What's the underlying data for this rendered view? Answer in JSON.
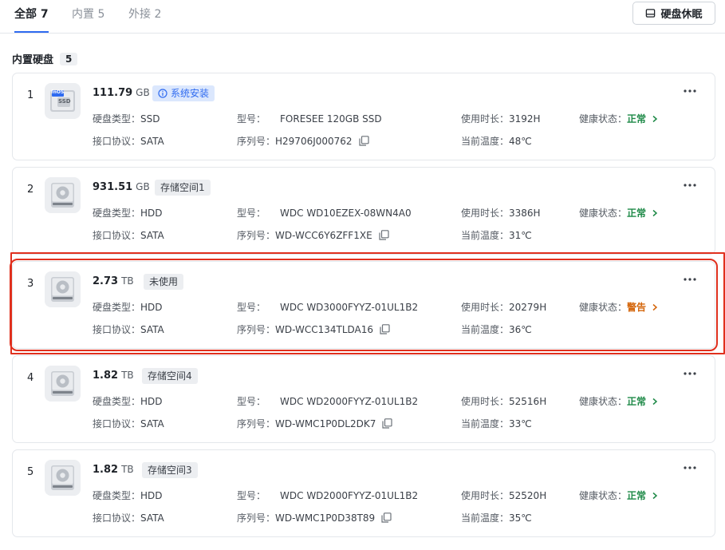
{
  "tabs": [
    {
      "label": "全部 7",
      "active": true
    },
    {
      "label": "内置 5",
      "active": false
    },
    {
      "label": "外接 2",
      "active": false
    }
  ],
  "sleep_button": {
    "label": "硬盘休眠",
    "icon": "bed-icon"
  },
  "section": {
    "title": "内置硬盘",
    "count": "5"
  },
  "labels": {
    "type": "硬盘类型：",
    "model": "型号：",
    "hours": "使用时长：",
    "health": "健康状态：",
    "proto": "接口协议：",
    "serial": "序列号：",
    "temp": "当前温度："
  },
  "colors": {
    "accent": "#2f6bf0",
    "ok": "#1f8a48",
    "warn": "#d4650a",
    "highlight": "#e0301e"
  },
  "disks": [
    {
      "index": "1",
      "capacity": "111.79",
      "unit": "GB",
      "tag": "系统安装",
      "tag_style": "blue",
      "icon": "ssd-fnos-icon",
      "icon_text_top": "fnOS",
      "icon_text_main": "SSD",
      "type": "SSD",
      "model": "FORESEE 120GB SSD",
      "hours": "3192H",
      "health": "正常",
      "health_state": "ok",
      "proto": "SATA",
      "serial": "H29706J000762",
      "temp": "48℃"
    },
    {
      "index": "2",
      "capacity": "931.51",
      "unit": "GB",
      "tag": "存储空间1",
      "tag_style": "gray",
      "icon": "hdd-icon",
      "type": "HDD",
      "model": "WDC WD10EZEX-08WN4A0",
      "hours": "3386H",
      "health": "正常",
      "health_state": "ok",
      "proto": "SATA",
      "serial": "WD-WCC6Y6ZFF1XE",
      "temp": "31℃"
    },
    {
      "index": "3",
      "capacity": "2.73",
      "unit": "TB",
      "tag": "未使用",
      "tag_style": "gray",
      "icon": "hdd-icon",
      "type": "HDD",
      "model": "WDC WD3000FYYZ-01UL1B2",
      "hours": "20279H",
      "health": "警告",
      "health_state": "warn",
      "proto": "SATA",
      "serial": "WD-WCC134TLDA16",
      "temp": "36℃"
    },
    {
      "index": "4",
      "capacity": "1.82",
      "unit": "TB",
      "tag": "存储空间4",
      "tag_style": "gray",
      "icon": "hdd-icon",
      "type": "HDD",
      "model": "WDC WD2000FYYZ-01UL1B2",
      "hours": "52516H",
      "health": "正常",
      "health_state": "ok",
      "proto": "SATA",
      "serial": "WD-WMC1P0DL2DK7",
      "temp": "33℃"
    },
    {
      "index": "5",
      "capacity": "1.82",
      "unit": "TB",
      "tag": "存储空间3",
      "tag_style": "gray",
      "icon": "hdd-icon",
      "type": "HDD",
      "model": "WDC WD2000FYYZ-01UL1B2",
      "hours": "52520H",
      "health": "正常",
      "health_state": "ok",
      "proto": "SATA",
      "serial": "WD-WMC1P0D38T89",
      "temp": "35℃"
    }
  ]
}
